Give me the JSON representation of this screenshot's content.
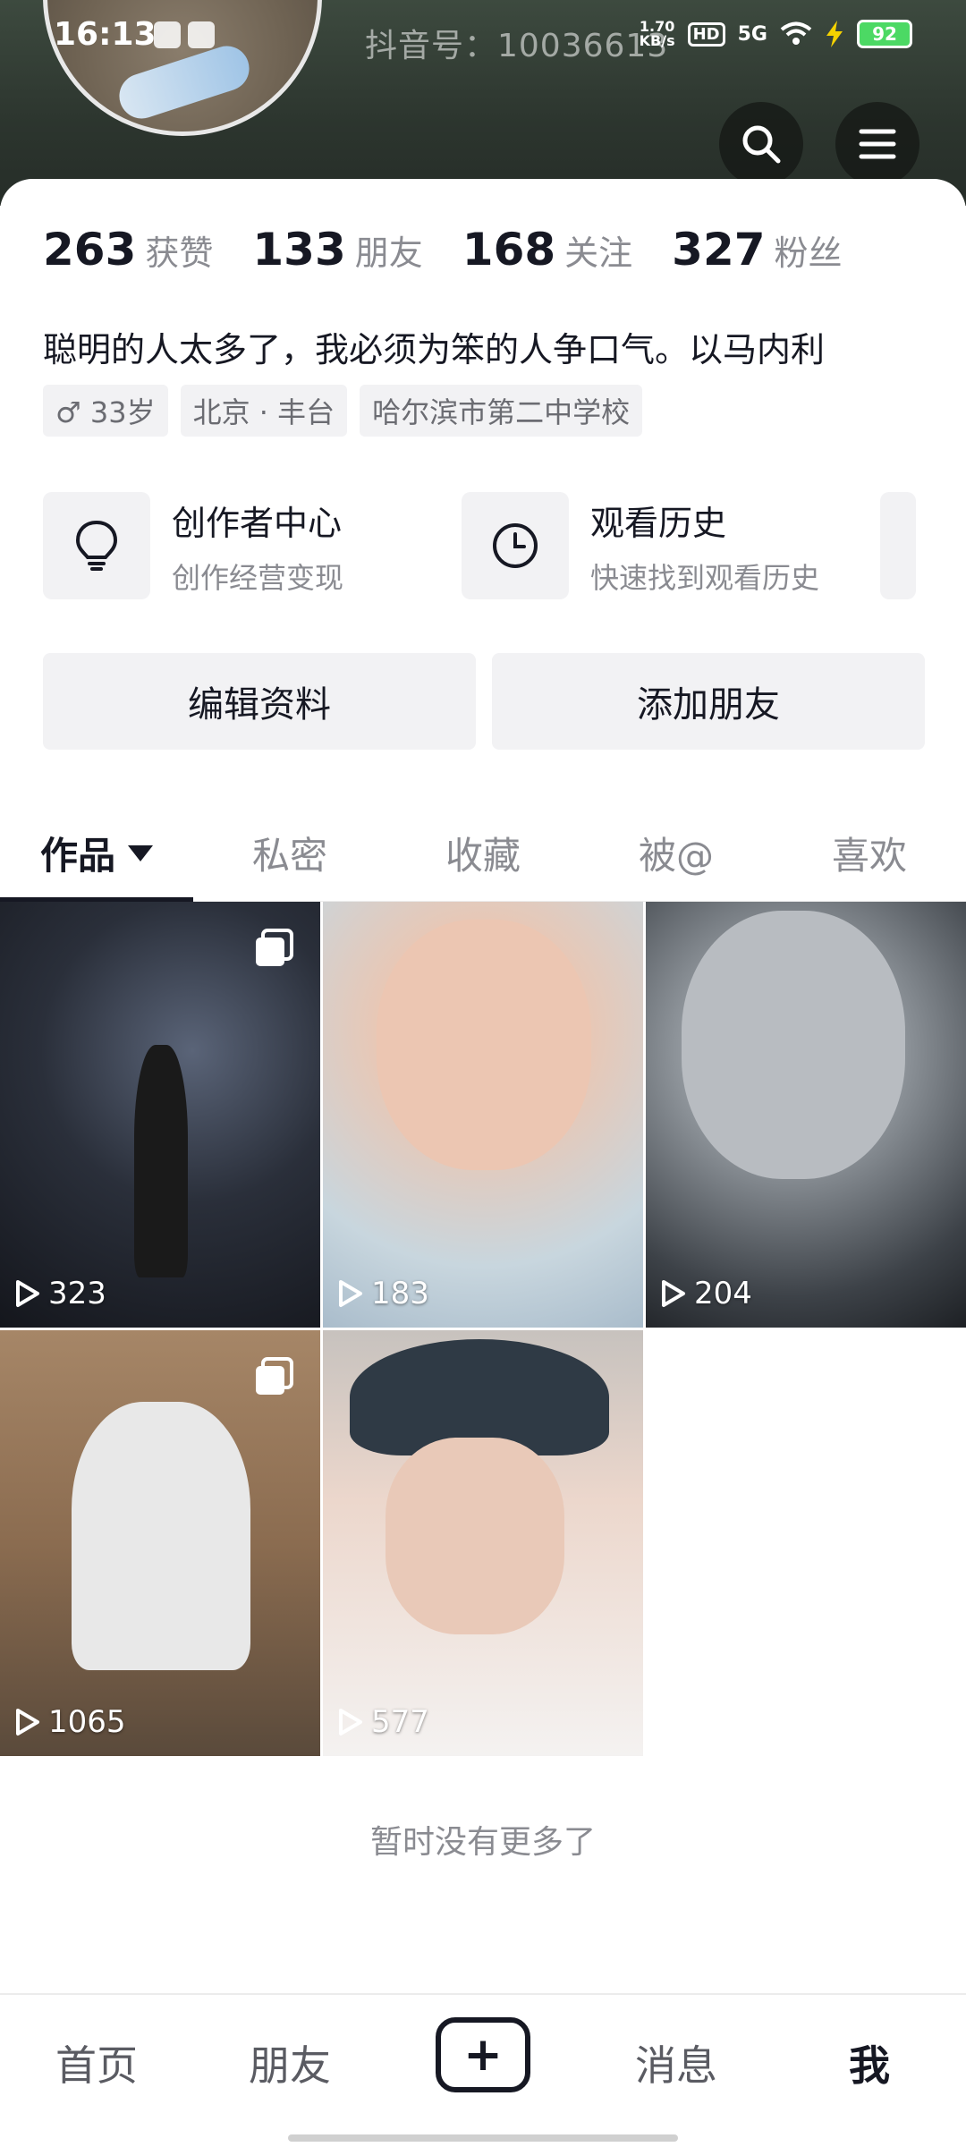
{
  "status_bar": {
    "time": "16:13",
    "net_speed": "1.70\nKB/s",
    "hd": "HD",
    "signal": "5G",
    "battery": "92"
  },
  "profile": {
    "douyin_id": "抖音号：10036613",
    "stats": [
      {
        "value": "263",
        "label": "获赞"
      },
      {
        "value": "133",
        "label": "朋友"
      },
      {
        "value": "168",
        "label": "关注"
      },
      {
        "value": "327",
        "label": "粉丝"
      }
    ],
    "bio": "聪明的人太多了，我必须为笨的人争口气。以马内利",
    "tags": {
      "gender_age": "♂ 33岁",
      "location": "北京 · 丰台",
      "school": "哈尔滨市第二中学校"
    }
  },
  "shortcuts": [
    {
      "title": "创作者中心",
      "subtitle": "创作经营变现",
      "icon": "lightbulb-icon"
    },
    {
      "title": "观看历史",
      "subtitle": "快速找到观看历史",
      "icon": "clock-icon"
    }
  ],
  "actions": {
    "edit_profile": "编辑资料",
    "add_friend": "添加朋友"
  },
  "tabs": [
    {
      "label": "作品",
      "active": true
    },
    {
      "label": "私密"
    },
    {
      "label": "收藏"
    },
    {
      "label": "被@"
    },
    {
      "label": "喜欢"
    }
  ],
  "videos": [
    {
      "plays": "323",
      "multi": true
    },
    {
      "plays": "183",
      "multi": false
    },
    {
      "plays": "204",
      "multi": false
    },
    {
      "plays": "1065",
      "multi": true
    },
    {
      "plays": "577",
      "multi": false
    }
  ],
  "feed_end_text": "暂时没有更多了",
  "bottom_nav": {
    "home": "首页",
    "friends": "朋友",
    "create": "+",
    "messages": "消息",
    "me": "我"
  },
  "colors": {
    "primary_text": "#161823",
    "secondary_text": "#8a8b91",
    "chip_bg": "#f2f2f4",
    "battery": "#4cd964"
  }
}
